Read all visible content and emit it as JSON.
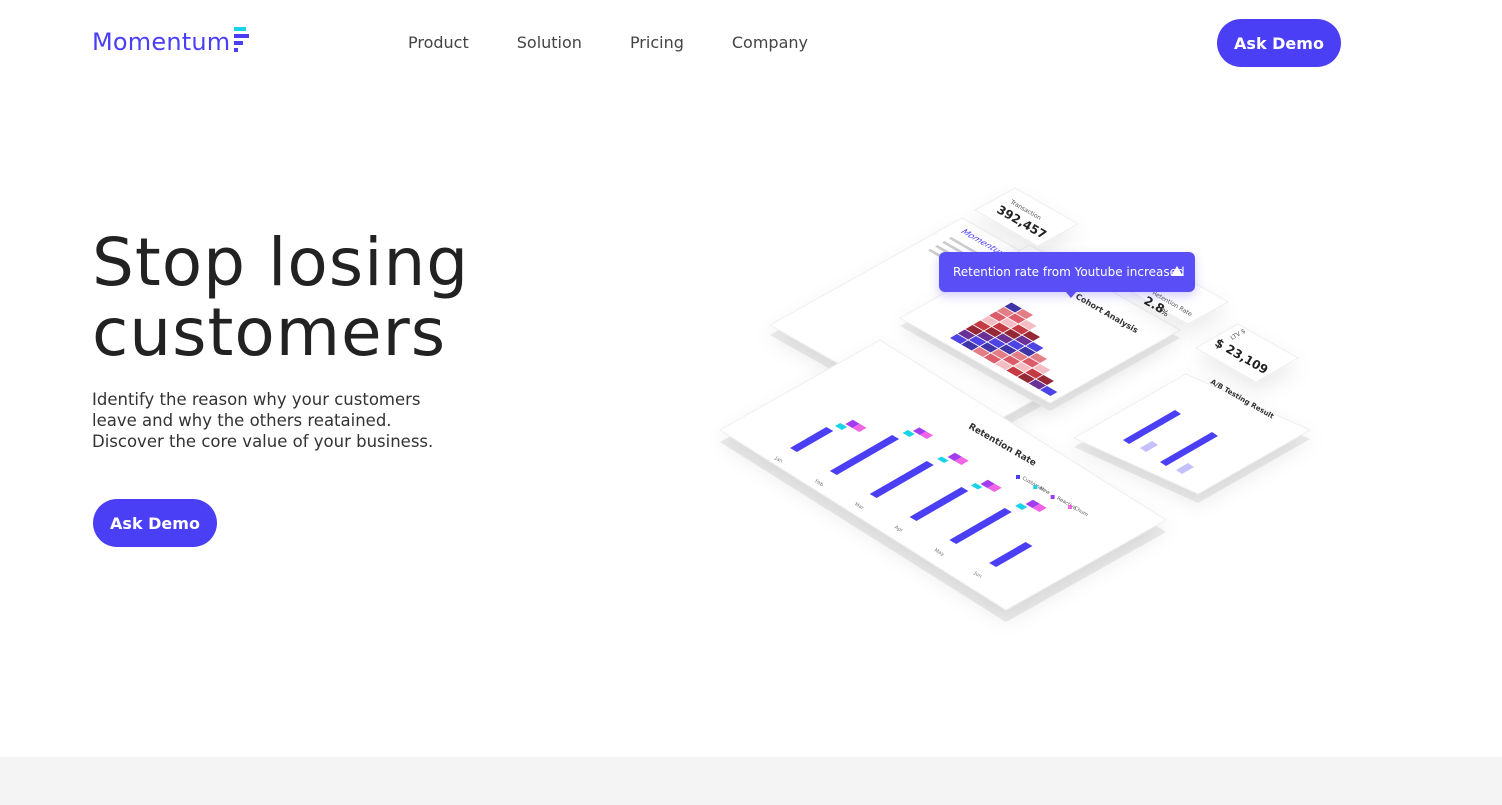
{
  "header": {
    "logo": "Momentum",
    "nav": [
      "Product",
      "Solution",
      "Pricing",
      "Company"
    ],
    "cta": "Ask Demo"
  },
  "hero": {
    "title_line1": "Stop losing",
    "title_line2": "customers",
    "subtitle_line1": "Identify the reason why your customers",
    "subtitle_line2": "leave and why the others reatained.",
    "subtitle_line3": "Discover the core value of your business.",
    "cta": "Ask Demo"
  },
  "illustration": {
    "tooltip": "Retention rate from Youtube increased",
    "transaction_label": "Transaction",
    "transaction_value": "392,457",
    "retention_card_label": "Retention Rate",
    "retention_card_value": "2.8",
    "retention_card_unit": "%",
    "ltv_label": "LTV $",
    "ltv_value": "$ 23,109",
    "cohort_title": "Cohort Analysis",
    "sidebar_logo": "Momentum",
    "ab_title": "A/B Testing Result",
    "main_chart_title": "Retention Rate",
    "legend": [
      "Customer",
      "New",
      "Reactive",
      "Churn"
    ],
    "months": [
      "Jan",
      "Feb",
      "Mar",
      "Apr",
      "May",
      "Jun"
    ],
    "colors": {
      "primary": "#4b3ff5",
      "cyan": "#19d3e6",
      "purple": "#a23cf0",
      "pink": "#f064e6"
    }
  }
}
